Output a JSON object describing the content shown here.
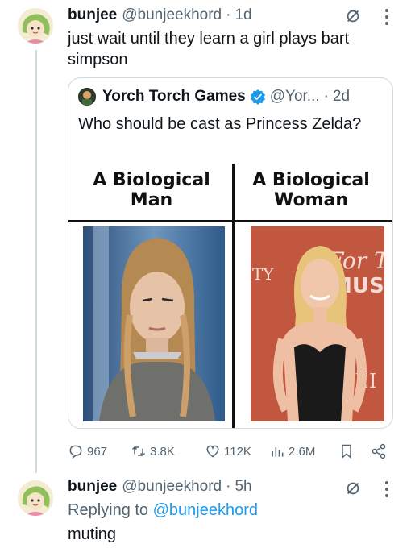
{
  "tweet1": {
    "name": "bunjee",
    "handle": "@bunjeekhord",
    "separator": "·",
    "time": "1d",
    "text": "just wait until they learn a girl plays bart simpson"
  },
  "quote": {
    "name": "Yorch Torch Games",
    "handle": "@Yor...",
    "separator": "·",
    "time": "2d",
    "text": "Who should be cast as Princess Zelda?",
    "meme": {
      "left_title": "A Biological Man",
      "right_title": "A Biological Woman",
      "right_backdrop_text": "For The MUSI"
    }
  },
  "actions": {
    "replies": "967",
    "reposts": "3.8K",
    "likes": "112K",
    "views": "2.6M"
  },
  "tweet2": {
    "name": "bunjee",
    "handle": "@bunjeekhord",
    "separator": "·",
    "time": "5h",
    "replying_prefix": "Replying to",
    "replying_to": "@bunjeekhord",
    "text": "muting"
  },
  "colors": {
    "link": "#1d9bf0",
    "muted": "#536471",
    "verified": "#1d9bf0"
  }
}
